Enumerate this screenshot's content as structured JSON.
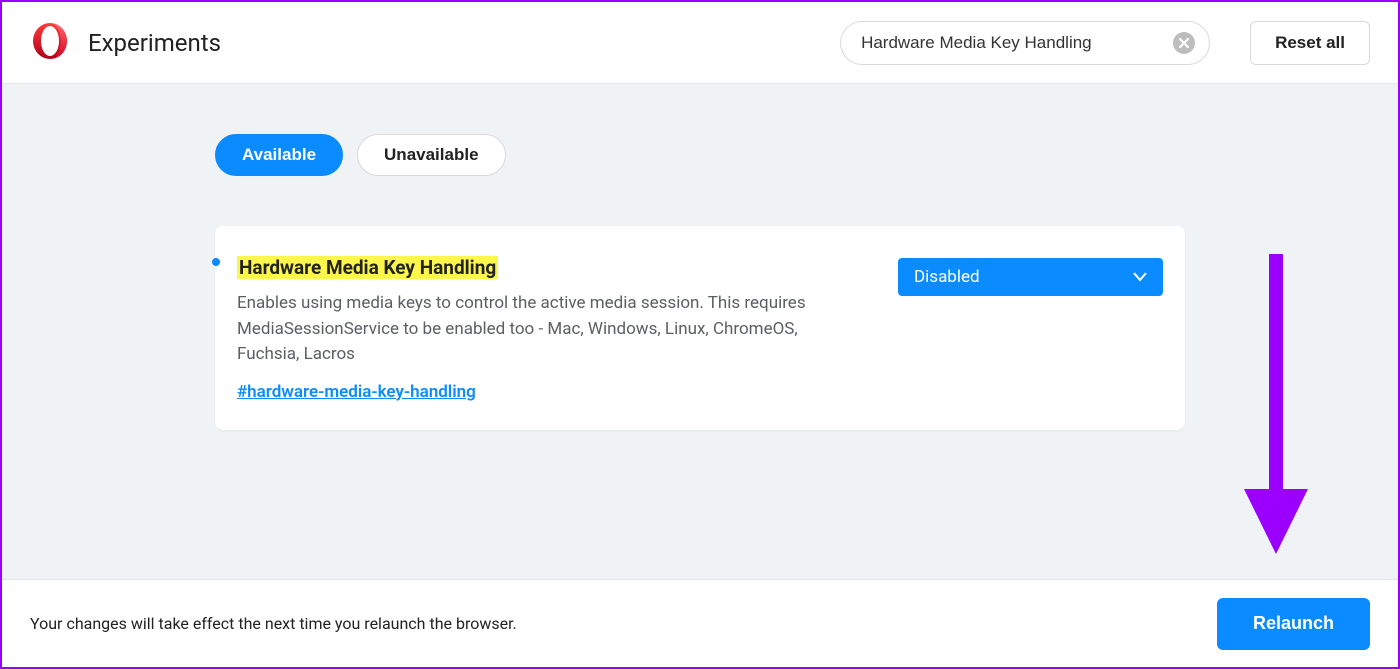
{
  "header": {
    "title": "Experiments",
    "search_value": "Hardware Media Key Handling",
    "reset_label": "Reset all"
  },
  "tabs": {
    "available": "Available",
    "unavailable": "Unavailable",
    "active": "available"
  },
  "flag": {
    "title": "Hardware Media Key Handling",
    "description": "Enables using media keys to control the active media session. This requires MediaSessionService to be enabled too - Mac, Windows, Linux, ChromeOS, Fuchsia, Lacros",
    "hash_link": "#hardware-media-key-handling",
    "dropdown_value": "Disabled"
  },
  "footer": {
    "message": "Your changes will take effect the next time you relaunch the browser.",
    "relaunch_label": "Relaunch"
  },
  "colors": {
    "accent": "#0a8bff",
    "highlight": "#fdf64b",
    "annotation": "#9b00ff"
  }
}
